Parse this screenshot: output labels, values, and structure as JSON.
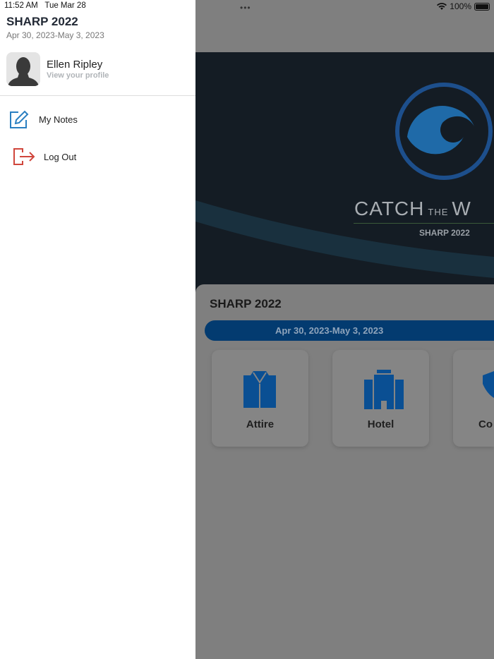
{
  "status_bar": {
    "time": "11:52 AM",
    "date": "Tue Mar 28",
    "battery": "100%",
    "dots": "•••"
  },
  "drawer": {
    "event_title": "SHARP 2022",
    "event_dates": "Apr 30, 2023-May 3, 2023",
    "user": {
      "name": "Ellen Ripley",
      "profile_link": "View your profile"
    },
    "menu": [
      {
        "label": "My Notes",
        "icon": "edit-icon",
        "color": "#2a7fc1"
      },
      {
        "label": "Log Out",
        "icon": "logout-icon",
        "color": "#d0463c"
      }
    ]
  },
  "main": {
    "banner": {
      "title_big": "CATCH",
      "title_small": "THE",
      "title_end": "W",
      "subtitle": "SHARP 2022"
    },
    "event_title": "SHARP 2022",
    "event_dates": "Apr 30, 2023-May 3, 2023",
    "tiles": [
      {
        "label": "Attire",
        "icon": "shirt-icon"
      },
      {
        "label": "Hotel",
        "icon": "hotel-icon"
      },
      {
        "label": "Co",
        "icon": "shield-icon"
      }
    ],
    "accent_color": "#0557a8"
  }
}
